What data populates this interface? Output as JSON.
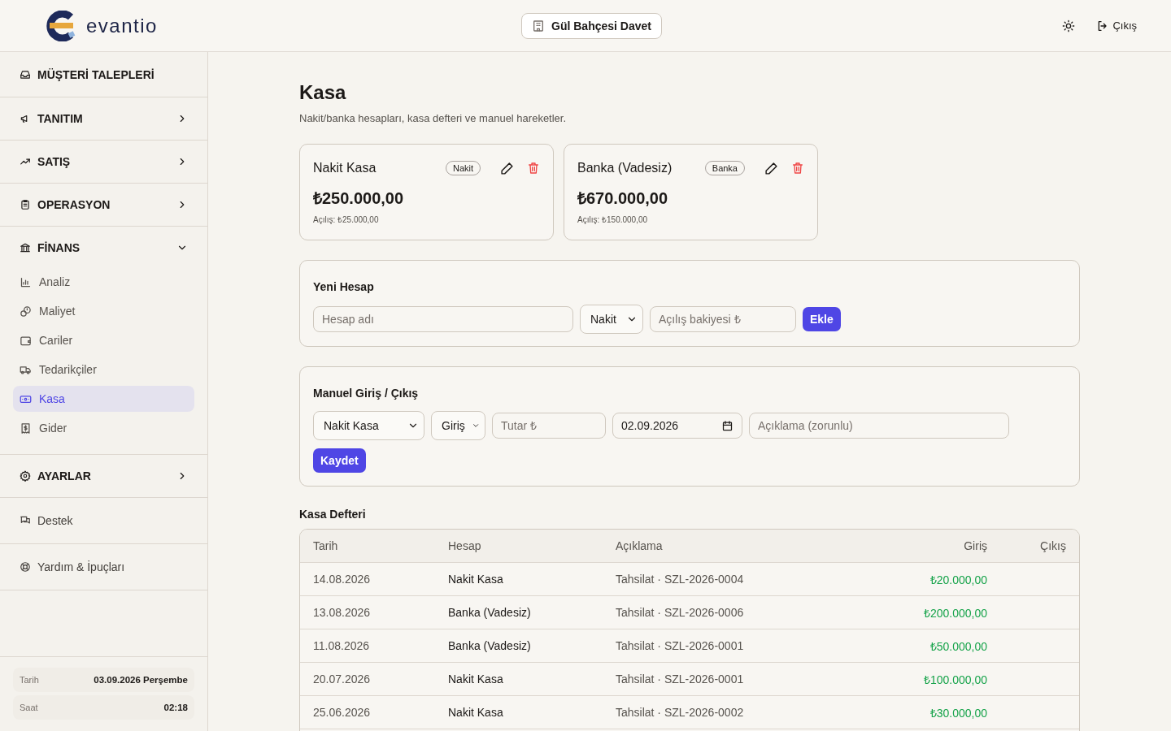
{
  "header": {
    "logo": "evantio",
    "workspace": "Gül Bahçesi Davet",
    "logout": "Çıkış"
  },
  "sidebar": {
    "sections": [
      {
        "label": "MÜŞTERİ TALEPLERİ",
        "kind": "link"
      },
      {
        "label": "TANITIM",
        "kind": "group",
        "expanded": false
      },
      {
        "label": "SATIŞ",
        "kind": "group",
        "expanded": false
      },
      {
        "label": "OPERASYON",
        "kind": "group",
        "expanded": false
      },
      {
        "label": "FİNANS",
        "kind": "group",
        "expanded": true,
        "children": [
          {
            "label": "Analiz",
            "selected": false
          },
          {
            "label": "Maliyet",
            "selected": false
          },
          {
            "label": "Cariler",
            "selected": false
          },
          {
            "label": "Tedarikçiler",
            "selected": false
          },
          {
            "label": "Kasa",
            "selected": true
          },
          {
            "label": "Gider",
            "selected": false
          }
        ]
      },
      {
        "label": "AYARLAR",
        "kind": "group",
        "expanded": false
      },
      {
        "label": "Destek",
        "kind": "plain"
      },
      {
        "label": "Yardım & İpuçları",
        "kind": "plain"
      }
    ],
    "footer": [
      {
        "label": "Tarih",
        "value": "03.09.2026 Perşembe"
      },
      {
        "label": "Saat",
        "value": "02:18"
      }
    ]
  },
  "page": {
    "title": "Kasa",
    "subtitle": "Nakit/banka hesapları, kasa defteri ve manuel hareketler.",
    "accounts": [
      {
        "name": "Nakit Kasa",
        "type": "Nakit",
        "balance": "₺250.000,00",
        "opening": "Açılış: ₺25.000,00"
      },
      {
        "name": "Banka (Vadesiz)",
        "type": "Banka",
        "balance": "₺670.000,00",
        "opening": "Açılış: ₺150.000,00"
      }
    ],
    "new_account": {
      "title": "Yeni Hesap",
      "name_placeholder": "Hesap adı",
      "type": "Nakit",
      "balance_placeholder": "Açılış bakiyesi ₺",
      "button": "Ekle"
    },
    "manual": {
      "title": "Manuel Giriş / Çıkış",
      "account": "Nakit Kasa",
      "direction": "Giriş",
      "amount_placeholder": "Tutar ₺",
      "date": "02.09.2026",
      "description_placeholder": "Açıklama (zorunlu)",
      "button": "Kaydet"
    },
    "ledger": {
      "title": "Kasa Defteri",
      "columns": [
        "Tarih",
        "Hesap",
        "Açıklama",
        "Giriş",
        "Çıkış"
      ],
      "rows": [
        {
          "date": "14.08.2026",
          "account": "Nakit Kasa",
          "description": "Tahsilat · SZL-2026-0004",
          "in": "₺20.000,00"
        },
        {
          "date": "13.08.2026",
          "account": "Banka (Vadesiz)",
          "description": "Tahsilat · SZL-2026-0006",
          "in": "₺200.000,00"
        },
        {
          "date": "11.08.2026",
          "account": "Banka (Vadesiz)",
          "description": "Tahsilat · SZL-2026-0001",
          "in": "₺50.000,00"
        },
        {
          "date": "20.07.2026",
          "account": "Nakit Kasa",
          "description": "Tahsilat · SZL-2026-0001",
          "in": "₺100.000,00"
        },
        {
          "date": "25.06.2026",
          "account": "Nakit Kasa",
          "description": "Tahsilat · SZL-2026-0002",
          "in": "₺30.000,00"
        }
      ]
    }
  }
}
